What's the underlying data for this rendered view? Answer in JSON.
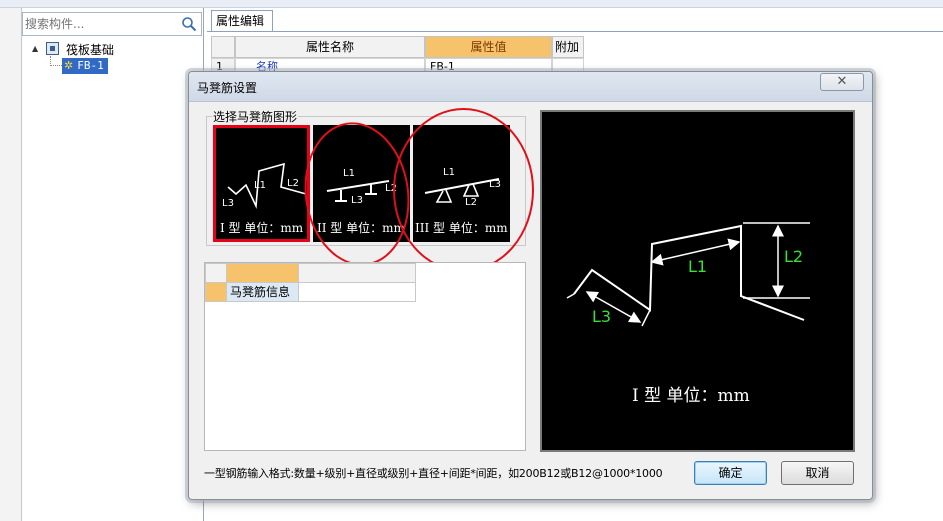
{
  "search": {
    "placeholder": "搜索构件..."
  },
  "tree": {
    "root_label": "筏板基础",
    "child_label": "FB-1",
    "expander_glyph": "▲"
  },
  "tab": {
    "label": "属性编辑"
  },
  "property_grid": {
    "headers": [
      "属性名称",
      "属性值",
      "附加"
    ],
    "rows": [
      {
        "index": "1",
        "name": "名称",
        "value": "FB-1"
      }
    ]
  },
  "dialog": {
    "title": "马凳筋设置",
    "close_glyph": "✕",
    "group_label": "选择马凳筋图形",
    "shapes": [
      {
        "id": "type1",
        "caption": "I 型  单位：mm",
        "selected": true,
        "labels": [
          "L1",
          "L2",
          "L3"
        ]
      },
      {
        "id": "type2",
        "caption": "II 型  单位：mm",
        "selected": false,
        "labels": [
          "L1",
          "L2",
          "L3"
        ]
      },
      {
        "id": "type3",
        "caption": "III 型  单位：mm",
        "selected": false,
        "labels": [
          "L1",
          "L2",
          "L3"
        ]
      }
    ],
    "info_grid": {
      "row_label": "马凳筋信息"
    },
    "preview": {
      "caption": "I 型  单位：mm",
      "labels": {
        "l1": "L1",
        "l2": "L2",
        "l3": "L3"
      }
    },
    "hint": "一型钢筋输入格式:数量+级别+直径或级别+直径+间距*间距，如200B12或B12@1000*1000",
    "ok_label": "确定",
    "cancel_label": "取消"
  },
  "colors": {
    "selection_red": "#e6001a",
    "annotation_circle": "#e0101a",
    "dimension_green": "#38e038",
    "tree_selected": "#3069c6",
    "value_header_orange": "#f6c26b"
  }
}
